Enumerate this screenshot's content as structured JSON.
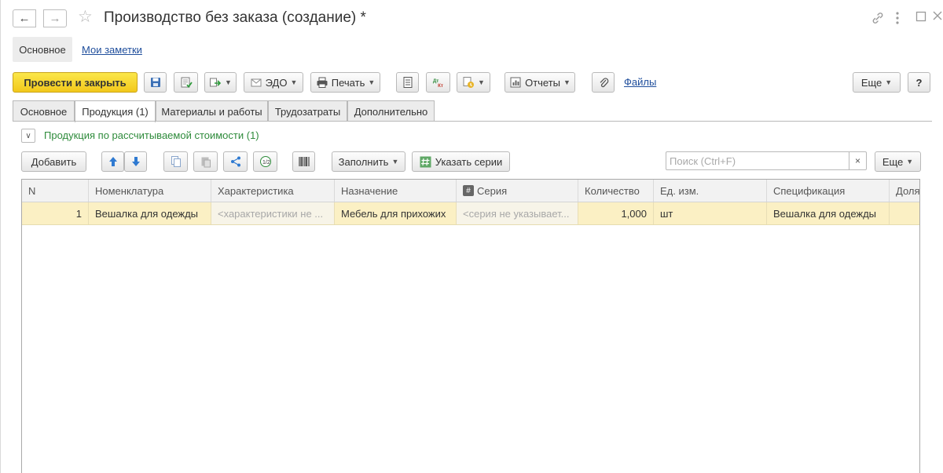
{
  "window": {
    "title": "Производство без заказа (создание) *",
    "nav_back_icon": "arrow-left-icon",
    "nav_forward_icon": "arrow-right-icon",
    "favorite_icon": "star-icon"
  },
  "sections": {
    "main": "Основное",
    "notes": "Мои заметки"
  },
  "commandbar": {
    "post_and_close": "Провести и закрыть",
    "edo": "ЭДО",
    "print": "Печать",
    "reports": "Отчеты",
    "files": "Файлы",
    "more": "Еще",
    "help": "?",
    "dt_kt": "Дт Кт"
  },
  "tabs": [
    {
      "label": "Основное",
      "active": false
    },
    {
      "label": "Продукция (1)",
      "active": true
    },
    {
      "label": "Материалы и работы",
      "active": false
    },
    {
      "label": "Трудозатраты",
      "active": false
    },
    {
      "label": "Дополнительно",
      "active": false
    }
  ],
  "group": {
    "title": "Продукция по рассчитываемой стоимости (1)"
  },
  "tablebar": {
    "add": "Добавить",
    "fill": "Заполнить",
    "set_series": "Указать серии",
    "search_placeholder": "Поиск (Ctrl+F)",
    "more": "Еще"
  },
  "table": {
    "columns": [
      "N",
      "Номенклатура",
      "Характеристика",
      "Назначение",
      "Серия",
      "Количество",
      "Ед. изм.",
      "Спецификация",
      "Доля"
    ],
    "rows": [
      {
        "n": "1",
        "item": "Вешалка для одежды",
        "characteristic": "<характеристики не ...",
        "purpose": "Мебель для прихожих",
        "series": "<серия не указывает...",
        "quantity": "1,000",
        "unit": "шт",
        "spec": "Вешалка для одежды",
        "share": ""
      }
    ]
  },
  "colors": {
    "primary_button": "#f5d22a",
    "selected_row": "#fbf0c4",
    "group_title": "#2e8b3b",
    "link": "#1f4e9c"
  }
}
